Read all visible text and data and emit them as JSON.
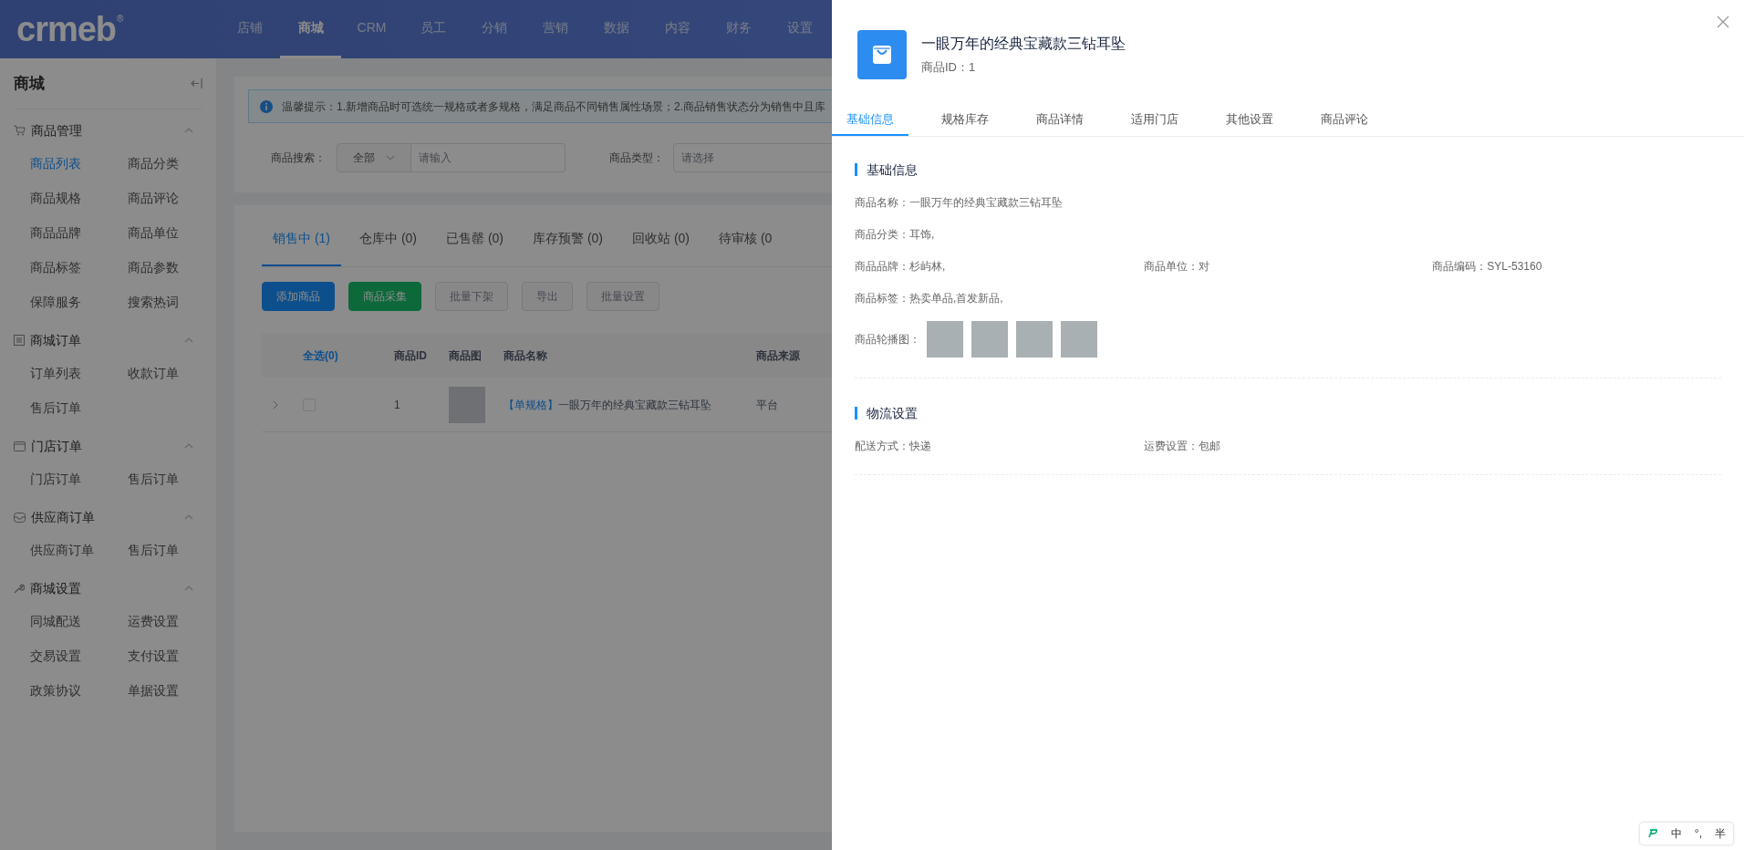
{
  "header": {
    "logo": "crmeb",
    "logo_mark": "®",
    "nav": [
      {
        "label": "店铺",
        "selected": false
      },
      {
        "label": "商城",
        "selected": true
      },
      {
        "label": "CRM",
        "selected": false
      },
      {
        "label": "员工",
        "selected": false
      },
      {
        "label": "分销",
        "selected": false
      },
      {
        "label": "营销",
        "selected": false
      },
      {
        "label": "数据",
        "selected": false
      },
      {
        "label": "内容",
        "selected": false
      },
      {
        "label": "财务",
        "selected": false
      },
      {
        "label": "设置",
        "selected": false
      }
    ]
  },
  "sidebar": {
    "title": "商城",
    "groups": [
      {
        "title": "商品管理",
        "expanded": true,
        "items": [
          {
            "label": "商品列表",
            "selected": true
          },
          {
            "label": "商品分类",
            "selected": false
          },
          {
            "label": "商品规格",
            "selected": false
          },
          {
            "label": "商品评论",
            "selected": false
          },
          {
            "label": "商品品牌",
            "selected": false
          },
          {
            "label": "商品单位",
            "selected": false
          },
          {
            "label": "商品标签",
            "selected": false
          },
          {
            "label": "商品参数",
            "selected": false
          },
          {
            "label": "保障服务",
            "selected": false
          },
          {
            "label": "搜索热词",
            "selected": false
          }
        ]
      },
      {
        "title": "商城订单",
        "expanded": true,
        "items": [
          {
            "label": "订单列表",
            "selected": false
          },
          {
            "label": "收款订单",
            "selected": false
          },
          {
            "label": "售后订单",
            "selected": false
          }
        ]
      },
      {
        "title": "门店订单",
        "expanded": true,
        "items": [
          {
            "label": "门店订单",
            "selected": false
          },
          {
            "label": "售后订单",
            "selected": false
          }
        ]
      },
      {
        "title": "供应商订单",
        "expanded": true,
        "items": [
          {
            "label": "供应商订单",
            "selected": false
          },
          {
            "label": "售后订单",
            "selected": false
          }
        ]
      },
      {
        "title": "商城设置",
        "expanded": true,
        "items": [
          {
            "label": "同城配送",
            "selected": false
          },
          {
            "label": "运费设置",
            "selected": false
          },
          {
            "label": "交易设置",
            "selected": false
          },
          {
            "label": "支付设置",
            "selected": false
          },
          {
            "label": "政策协议",
            "selected": false
          },
          {
            "label": "单据设置",
            "selected": false
          }
        ]
      }
    ]
  },
  "notice": {
    "text": "温馨提示：1.新增商品时可选统一规格或者多规格，满足商品不同销售属性场景；2.商品销售状态分为销售中且库"
  },
  "filters": [
    {
      "kind": "search",
      "label": "商品搜索：",
      "select_value": "全部",
      "placeholder": "请输入"
    },
    {
      "kind": "select",
      "label": "商品类型：",
      "placeholder": "请选择"
    }
  ],
  "status_tabs": [
    {
      "label": "销售中 (1)",
      "selected": true
    },
    {
      "label": "仓库中 (0)",
      "selected": false
    },
    {
      "label": "已售罄 (0)",
      "selected": false
    },
    {
      "label": "库存预警 (0)",
      "selected": false
    },
    {
      "label": "回收站 (0)",
      "selected": false
    },
    {
      "label": "待审核 (0",
      "selected": false
    }
  ],
  "actions": [
    {
      "label": "添加商品",
      "kind": "primary"
    },
    {
      "label": "商品采集",
      "kind": "success"
    },
    {
      "label": "批量下架",
      "kind": "disabled"
    },
    {
      "label": "导出",
      "kind": "disabled"
    },
    {
      "label": "批量设置",
      "kind": "disabled"
    }
  ],
  "table": {
    "select_all": "全选(0)",
    "columns": [
      "商品ID",
      "商品图",
      "商品名称",
      "商品来源"
    ],
    "rows": [
      {
        "checked": false,
        "id": "1",
        "tag": "【单规格】",
        "name": "一眼万年的经典宝藏款三钻耳坠",
        "source": "平台"
      }
    ]
  },
  "drawer": {
    "title": "一眼万年的经典宝藏款三钻耳坠",
    "subtitle": "商品ID：1",
    "tabs": [
      {
        "label": "基础信息",
        "selected": true
      },
      {
        "label": "规格库存",
        "selected": false
      },
      {
        "label": "商品详情",
        "selected": false
      },
      {
        "label": "适用门店",
        "selected": false
      },
      {
        "label": "其他设置",
        "selected": false
      },
      {
        "label": "商品评论",
        "selected": false
      }
    ],
    "sections": [
      {
        "title": "基础信息",
        "rows": [
          {
            "kind": "fields",
            "fields": [
              {
                "label": "商品名称：",
                "value": "一眼万年的经典宝藏款三钻耳坠"
              }
            ]
          },
          {
            "kind": "fields",
            "fields": [
              {
                "label": "商品分类：",
                "value": "耳饰,"
              }
            ]
          },
          {
            "kind": "fields",
            "fields": [
              {
                "label": "商品品牌：",
                "value": "杉屿林,"
              },
              {
                "label": "商品单位：",
                "value": "对"
              },
              {
                "label": "商品编码：",
                "value": "SYL-53160"
              }
            ]
          },
          {
            "kind": "fields",
            "fields": [
              {
                "label": "商品标签：",
                "value": "热卖单品,首发新品,"
              }
            ]
          },
          {
            "kind": "images",
            "label": "商品轮播图：",
            "images": [
              {
                "kind": "photo"
              },
              {
                "kind": "photo"
              },
              {
                "kind": "photo"
              },
              {
                "kind": "photo"
              }
            ]
          }
        ]
      },
      {
        "title": "物流设置",
        "rows": [
          {
            "kind": "fields",
            "fields": [
              {
                "label": "配送方式：",
                "value": "快递"
              },
              {
                "label": "运费设置：",
                "value": "包邮"
              }
            ]
          }
        ]
      }
    ]
  },
  "ime": {
    "items": [
      "中",
      "°,",
      "半"
    ]
  }
}
